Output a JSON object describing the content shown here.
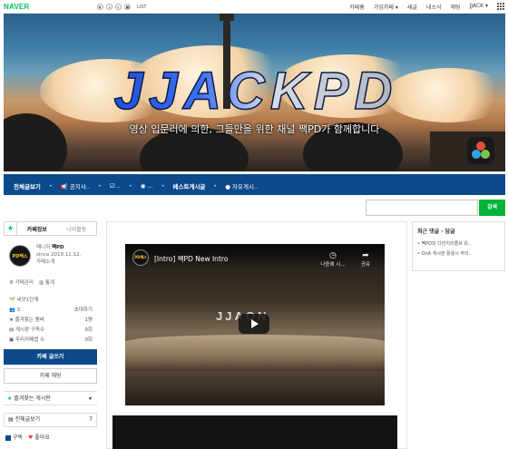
{
  "topbar": {
    "logo": "NAVER",
    "player_title": "LIST",
    "nav": [
      "카페홈",
      "가입카페",
      "새글",
      "내소식",
      "채팅",
      "JJACK"
    ]
  },
  "banner": {
    "logo_text": "JJACKPD",
    "slogan": "영상 입문러에 의한, 그들만을 위한 채널 짹PD가 함께합니다"
  },
  "menubar": {
    "items": [
      "전체글보기",
      "공지사..",
      "..",
      "...",
      "베스트게시글",
      "자유게시.."
    ]
  },
  "search": {
    "placeholder": "",
    "button": "검색"
  },
  "sidebar": {
    "tab_active": "카페정보",
    "tab_inactive": "나의활동",
    "avatar_text": "PD짹스",
    "manager_label": "매니저",
    "manager_name": "짹PD",
    "since": "since 2019.11.12.",
    "cafe_intro": "카페소개",
    "admin": "카페관리",
    "stats_link": "통계",
    "level": "씨앗1단계",
    "members_count": "3",
    "invite": "초대하기",
    "stats": [
      {
        "label": "즐겨찾는 멤버",
        "value": "1명"
      },
      {
        "label": "게시판 구독수",
        "value": "0회"
      },
      {
        "label": "우리카페앱 수",
        "value": "0회"
      }
    ],
    "write_button": "카페 글쓰기",
    "chat_button": "카페 채팅",
    "fav_board": "즐겨찾는 게시판",
    "all_posts": "전체글보기",
    "all_posts_count": "7",
    "subscribe": "구독",
    "like": "좋아요"
  },
  "content": {
    "video_icon_text": "PD짹스",
    "video_title": "[Intro] 짹PD New Intro",
    "watch_later": "나중에 시...",
    "share": "공유",
    "overlay_text": "JJAON"
  },
  "widget": {
    "title": "최근 댓글 · 답글",
    "items": [
      "짹PD와 다빈치리졸브 유..",
      "QnA 게시판 활용시 주의.."
    ]
  },
  "colors": {
    "brand_green": "#03c75a",
    "menu_blue": "#0c4a8c",
    "search_green": "#00b43a"
  }
}
